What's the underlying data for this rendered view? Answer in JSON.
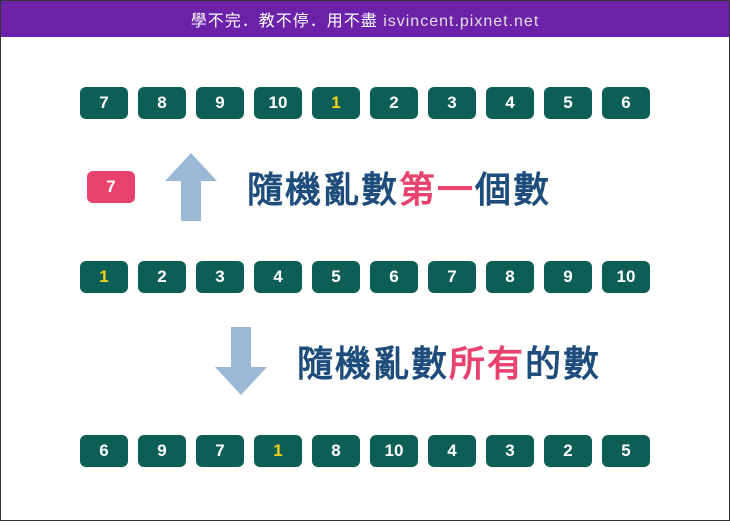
{
  "header": {
    "text": "學不完．教不停．用不盡",
    "site": "isvincent.pixnet.net"
  },
  "rows": {
    "top": [
      "7",
      "8",
      "9",
      "10",
      "1",
      "2",
      "3",
      "4",
      "5",
      "6"
    ],
    "middle": [
      "1",
      "2",
      "3",
      "4",
      "5",
      "6",
      "7",
      "8",
      "9",
      "10"
    ],
    "bottom": [
      "6",
      "9",
      "7",
      "1",
      "8",
      "10",
      "4",
      "3",
      "2",
      "5"
    ]
  },
  "highlight_value": "1",
  "solo_value": "7",
  "captions": {
    "first": {
      "pre": "隨機亂數",
      "hl": "第一",
      "post": "個數"
    },
    "second": {
      "pre": "隨機亂數",
      "hl": "所有",
      "post": "的數"
    }
  },
  "colors": {
    "teal": "#0d5f56",
    "pink": "#e8436f",
    "arrow": "#9bb9d6",
    "caption": "#1e4d7b"
  }
}
